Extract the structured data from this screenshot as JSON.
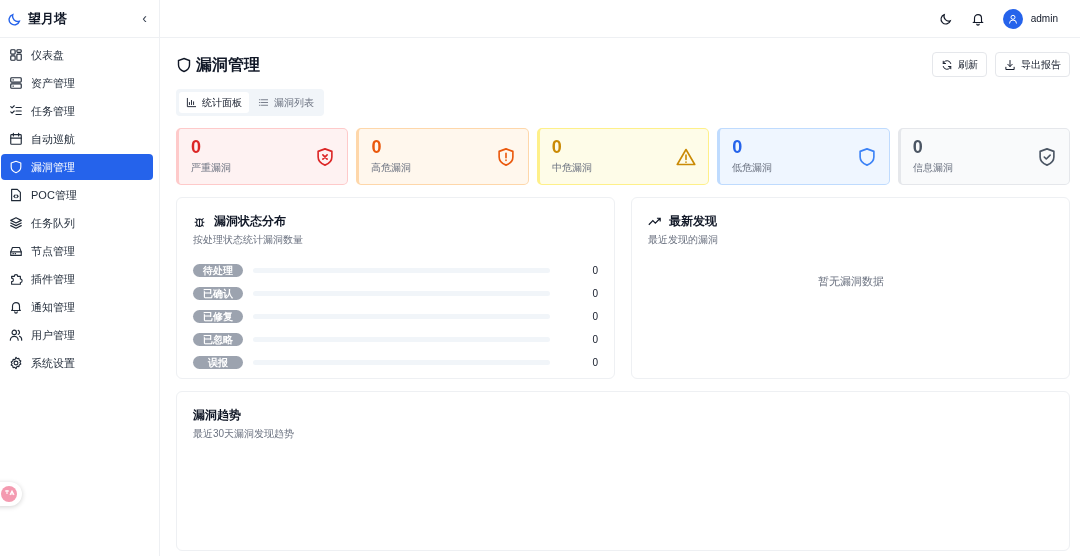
{
  "brand": {
    "name": "望月塔",
    "collapse": "‹"
  },
  "header": {
    "user": "admin"
  },
  "sidebar": {
    "items": [
      {
        "label": "仪表盘",
        "selected": false
      },
      {
        "label": "资产管理",
        "selected": false
      },
      {
        "label": "任务管理",
        "selected": false
      },
      {
        "label": "自动巡航",
        "selected": false
      },
      {
        "label": "漏洞管理",
        "selected": true
      },
      {
        "label": "POC管理",
        "selected": false
      },
      {
        "label": "任务队列",
        "selected": false
      },
      {
        "label": "节点管理",
        "selected": false
      },
      {
        "label": "插件管理",
        "selected": false
      },
      {
        "label": "通知管理",
        "selected": false
      },
      {
        "label": "用户管理",
        "selected": false
      },
      {
        "label": "系统设置",
        "selected": false
      }
    ]
  },
  "page": {
    "title": "漏洞管理",
    "actions": [
      "刷新",
      "导出报告"
    ]
  },
  "tabs": [
    {
      "label": "统计面板",
      "selected": true
    },
    {
      "label": "漏洞列表",
      "selected": false
    }
  ],
  "severity_cards": [
    {
      "kind": "critical",
      "count": "0",
      "label": "严重漏洞"
    },
    {
      "kind": "high",
      "count": "0",
      "label": "高危漏洞"
    },
    {
      "kind": "medium",
      "count": "0",
      "label": "中危漏洞"
    },
    {
      "kind": "low",
      "count": "0",
      "label": "低危漏洞"
    },
    {
      "kind": "info",
      "count": "0",
      "label": "信息漏洞"
    }
  ],
  "status_panel": {
    "title": "漏洞状态分布",
    "subtitle": "按处理状态统计漏洞数量",
    "rows": [
      {
        "status": "待处理",
        "level": 0,
        "count": "0"
      },
      {
        "status": "已确认",
        "level": 0,
        "count": "0"
      },
      {
        "status": "已修复",
        "level": 0,
        "count": "0"
      },
      {
        "status": "已忽略",
        "level": 0,
        "count": "0"
      },
      {
        "status": "误报",
        "level": 0,
        "count": "0"
      }
    ]
  },
  "recent_panel": {
    "title": "最新发现",
    "subtitle": "最近发现的漏洞",
    "empty": "暂无漏洞数据"
  },
  "trend_panel": {
    "title": "漏洞趋势",
    "subtitle": "最近30天漏洞发现趋势"
  }
}
